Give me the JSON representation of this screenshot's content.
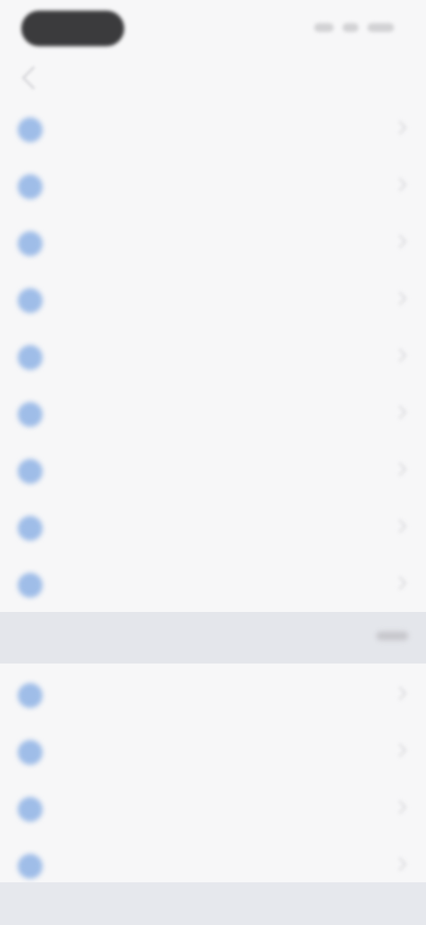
{
  "status_bar": {
    "time_pill": "",
    "indicators": ""
  },
  "nav": {
    "title": ""
  },
  "items": [
    {
      "label": "",
      "icon": "circle-icon"
    },
    {
      "label": "",
      "icon": "circle-icon"
    },
    {
      "label": "",
      "icon": "circle-icon"
    },
    {
      "label": "",
      "icon": "circle-icon"
    },
    {
      "label": "",
      "icon": "circle-icon"
    },
    {
      "label": "",
      "icon": "circle-icon"
    },
    {
      "label": "",
      "icon": "circle-icon"
    },
    {
      "label": "",
      "icon": "circle-icon"
    },
    {
      "label": "",
      "icon": "circle-icon"
    }
  ],
  "section": {
    "label": "",
    "value": ""
  },
  "items2": [
    {
      "label": "",
      "icon": "circle-icon"
    },
    {
      "label": "",
      "icon": "circle-icon"
    },
    {
      "label": "",
      "icon": "circle-icon"
    },
    {
      "label": "",
      "icon": "circle-icon"
    }
  ],
  "colors": {
    "accent": "#9fbde8",
    "section_bg": "#e4e6eb",
    "background": "#f7f7f8"
  }
}
